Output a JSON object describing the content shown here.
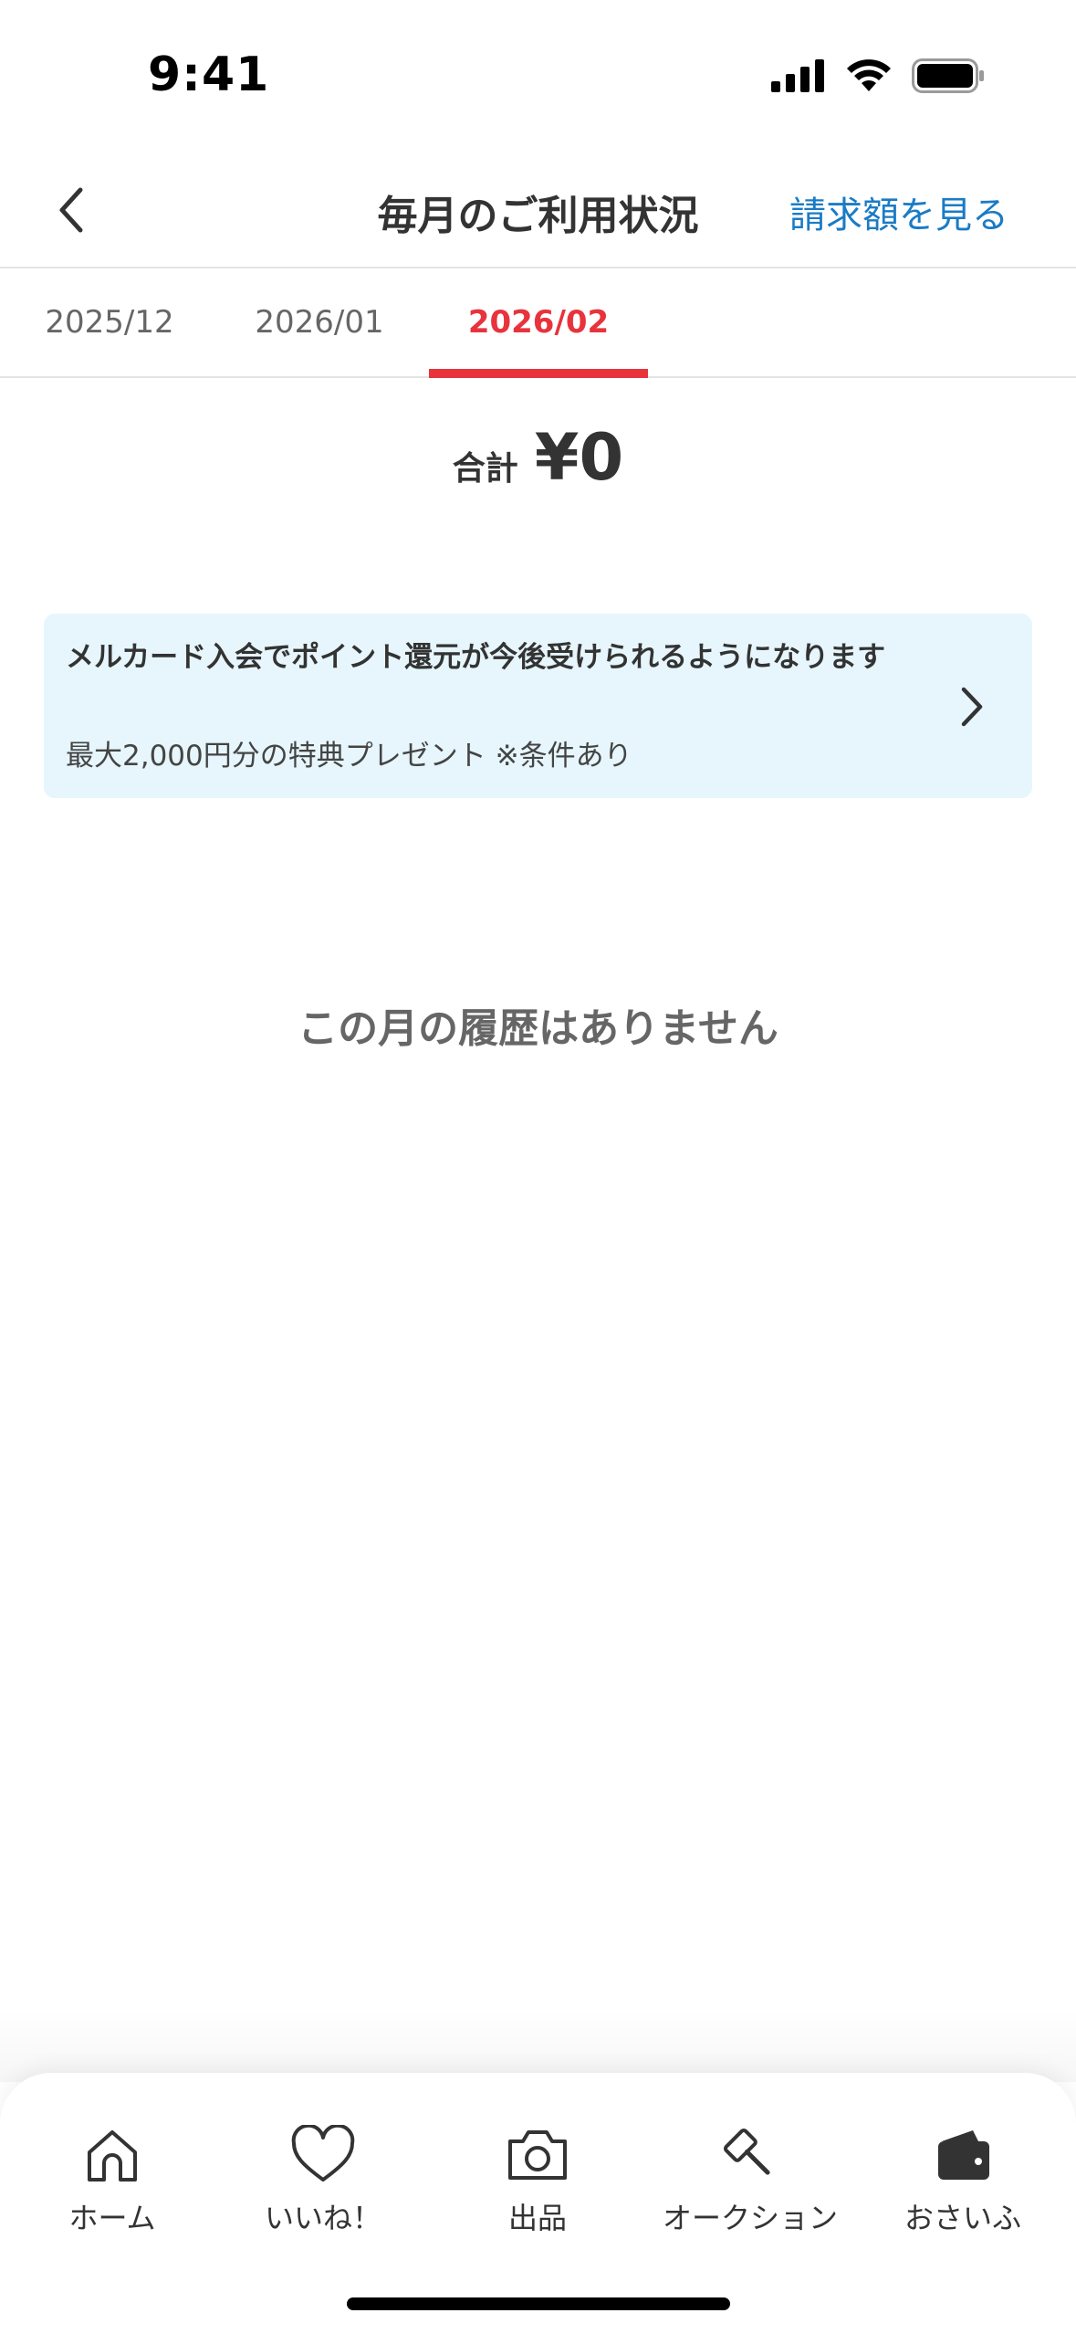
{
  "status_bar": {
    "time": "9:41"
  },
  "nav": {
    "title": "毎月のご利用状況",
    "action_label": "請求額を見る"
  },
  "tabs": [
    {
      "label": "2025/12",
      "active": false
    },
    {
      "label": "2026/01",
      "active": false
    },
    {
      "label": "2026/02",
      "active": true
    }
  ],
  "summary": {
    "label": "合計",
    "amount": "¥0"
  },
  "banner": {
    "title": "メルカード入会でポイント還元が今後受けられるようになります",
    "subtitle": "最大2,000円分の特典プレゼント ※条件あり"
  },
  "empty_message": "この月の履歴はありません",
  "tabbar": {
    "items": [
      {
        "label": "ホーム",
        "icon": "home-icon"
      },
      {
        "label": "いいね！",
        "icon": "heart-icon"
      },
      {
        "label": "出品",
        "icon": "camera-icon"
      },
      {
        "label": "オークション",
        "icon": "gavel-icon"
      },
      {
        "label": "おさいふ",
        "icon": "wallet-icon"
      }
    ]
  },
  "colors": {
    "accent": "#e8333d",
    "link": "#1a7bc5",
    "banner_bg": "#e6f6fc",
    "text": "#333333"
  }
}
